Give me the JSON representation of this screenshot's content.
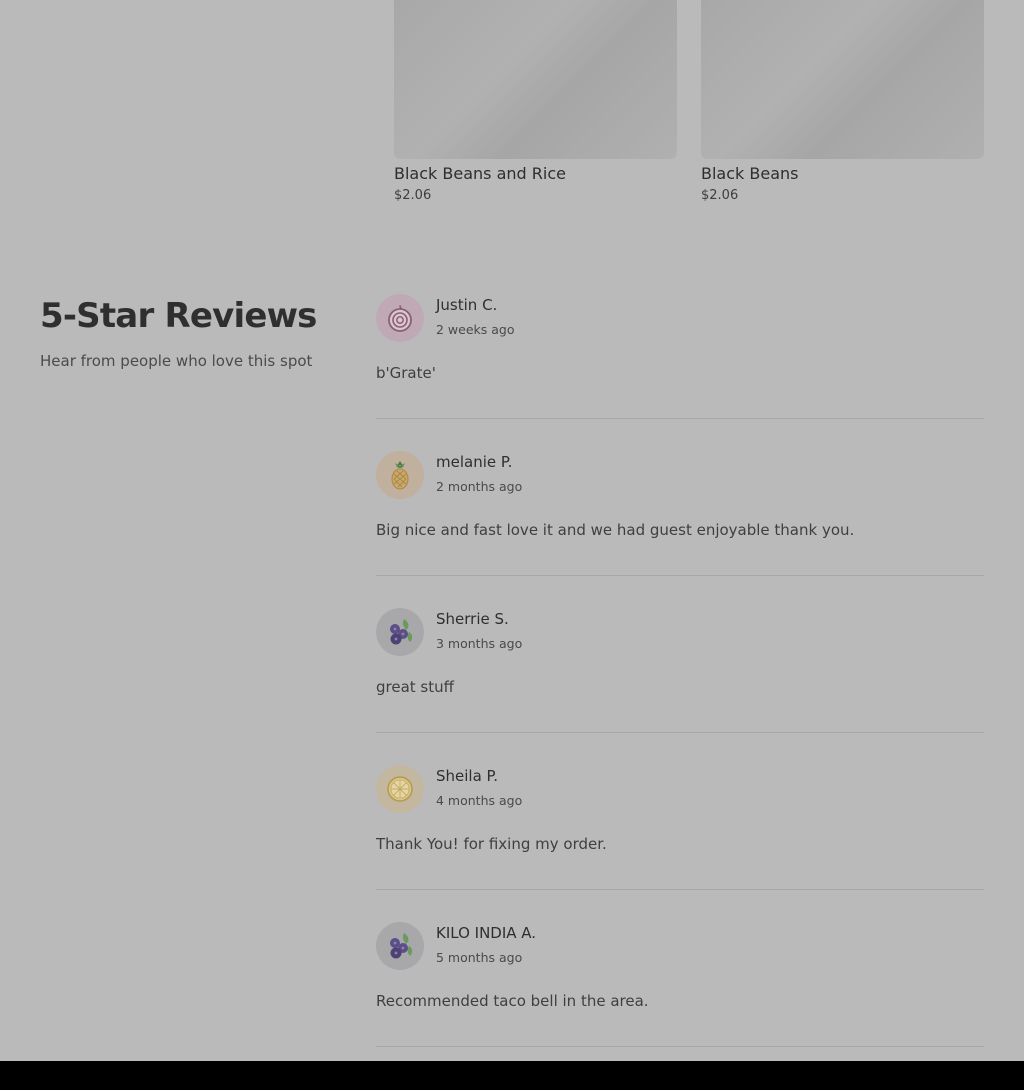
{
  "menu_items": [
    {
      "name": "Black Beans and Rice",
      "price": "$2.06"
    },
    {
      "name": "Black Beans",
      "price": "$2.06"
    }
  ],
  "reviews_section": {
    "title": "5-Star Reviews",
    "subtitle": "Hear from people who love this spot"
  },
  "reviews": [
    {
      "author": "Justin C.",
      "date": "2 weeks ago",
      "text": "b'Grate'",
      "avatar_icon": "onion-icon"
    },
    {
      "author": "melanie P.",
      "date": "2 months ago",
      "text": "Big nice and fast love it and we had guest enjoyable thank you.",
      "avatar_icon": "pineapple-icon"
    },
    {
      "author": "Sherrie S.",
      "date": "3 months ago",
      "text": "great stuff",
      "avatar_icon": "blueberries-icon"
    },
    {
      "author": "Sheila P.",
      "date": "4 months ago",
      "text": "Thank You! for fixing my order.",
      "avatar_icon": "lemon-slice-icon"
    },
    {
      "author": "KILO INDIA A.",
      "date": "5 months ago",
      "text": "Recommended taco bell in the area.",
      "avatar_icon": "blueberries-icon"
    }
  ],
  "colors": {
    "page_background": "#bababa",
    "footer_bar": "#000000",
    "divider": "#a7a7a7"
  }
}
